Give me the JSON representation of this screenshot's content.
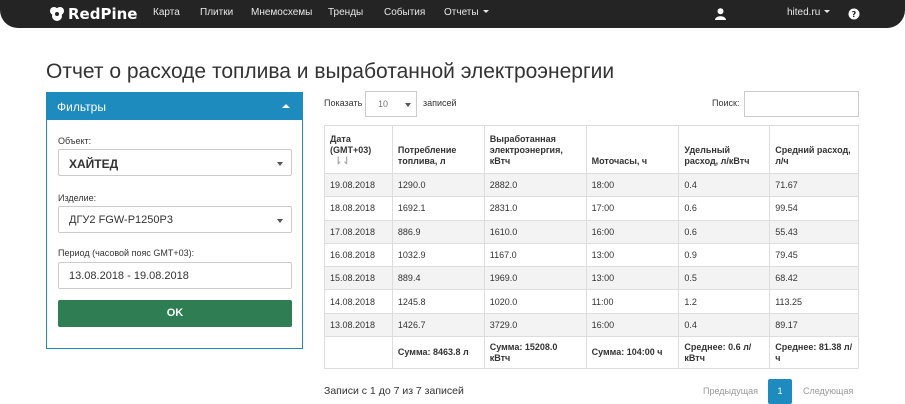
{
  "navbar": {
    "brand": "RedPine",
    "items": [
      "Карта",
      "Плитки",
      "Мнемосхемы",
      "Тренды",
      "События",
      "Отчеты"
    ],
    "user_domain": "hited.ru"
  },
  "page": {
    "title": "Отчет о расходе топлива и выработанной электроэнергии"
  },
  "filters": {
    "header": "Фильтры",
    "object_label": "Объект:",
    "object_value": "ХАЙТЕД",
    "product_label": "Изделие:",
    "product_value": "ДГУ2 FGW-P1250P3",
    "period_label": "Период (часовой пояс GMT+03):",
    "period_value": "13.08.2018 - 19.08.2018",
    "ok_label": "OK"
  },
  "controls": {
    "show_label": "Показать",
    "page_size": "10",
    "records_label": "записей",
    "search_label": "Поиск:"
  },
  "table": {
    "headers": [
      [
        "Дата",
        "(GMT+03)"
      ],
      [
        "Потребление",
        "топлива, л"
      ],
      [
        "Выработанная",
        "электроэнергия,",
        "кВтч"
      ],
      [
        "Моточасы, ч"
      ],
      [
        "Удельный",
        "расход, л/кВтч"
      ],
      [
        "Средний расход,",
        "л/ч"
      ]
    ],
    "rows": [
      [
        "19.08.2018",
        "1290.0",
        "2882.0",
        "18:00",
        "0.4",
        "71.67"
      ],
      [
        "18.08.2018",
        "1692.1",
        "2831.0",
        "17:00",
        "0.6",
        "99.54"
      ],
      [
        "17.08.2018",
        "886.9",
        "1610.0",
        "16:00",
        "0.6",
        "55.43"
      ],
      [
        "16.08.2018",
        "1032.9",
        "1167.0",
        "13:00",
        "0.9",
        "79.45"
      ],
      [
        "15.08.2018",
        "889.4",
        "1969.0",
        "13:00",
        "0.5",
        "68.42"
      ],
      [
        "14.08.2018",
        "1245.8",
        "1020.0",
        "11:00",
        "1.2",
        "113.25"
      ],
      [
        "13.08.2018",
        "1426.7",
        "3729.0",
        "16:00",
        "0.4",
        "89.17"
      ]
    ],
    "footer": [
      "",
      "Сумма: 8463.8 л",
      [
        "Сумма: 15208.0",
        "кВтч"
      ],
      "Сумма: 104:00 ч",
      [
        "Среднее: 0.6 л/",
        "кВтч"
      ],
      [
        "Среднее: 81.38 л/",
        "ч"
      ]
    ]
  },
  "pagination": {
    "info": "Записи с 1 до 7 из 7 записей",
    "prev": "Предыдущая",
    "current": "1",
    "next": "Следующая"
  }
}
